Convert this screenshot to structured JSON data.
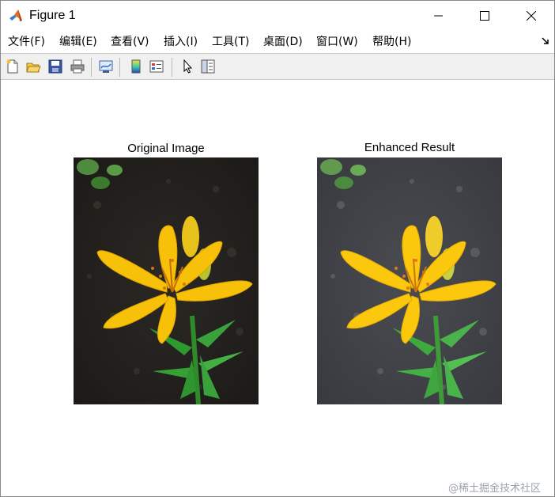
{
  "window": {
    "title": "Figure 1",
    "icon": "matlab-logo-icon"
  },
  "menubar": {
    "items": [
      "文件(F)",
      "编辑(E)",
      "查看(V)",
      "插入(I)",
      "工具(T)",
      "桌面(D)",
      "窗口(W)",
      "帮助(H)"
    ],
    "overflow_icon": "dock-arrow-icon"
  },
  "toolbar": {
    "buttons": [
      "new-figure-icon",
      "open-file-icon",
      "save-icon",
      "print-icon",
      "link-plot-icon",
      "insert-colorbar-icon",
      "insert-legend-icon",
      "pointer-icon",
      "property-inspector-icon"
    ]
  },
  "figure": {
    "axes": [
      {
        "title": "Original Image"
      },
      {
        "title": "Enhanced Result"
      }
    ]
  },
  "watermark": "@稀土掘金技术社区"
}
